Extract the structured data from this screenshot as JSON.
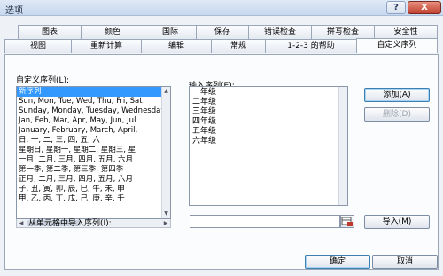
{
  "window": {
    "title": "选项",
    "help": "?",
    "close": "X"
  },
  "tabs_row1": [
    "图表",
    "颜色",
    "国际",
    "保存",
    "错误检查",
    "拼写检查",
    "安全性"
  ],
  "tabs_row2": [
    "视图",
    "重新计算",
    "编辑",
    "常规",
    "1-2-3 的帮助",
    "自定义序列"
  ],
  "active_tab": "自定义序列",
  "custom_lists": {
    "label": "自定义序列(L):",
    "items": [
      "新序列",
      "Sun, Mon, Tue, Wed, Thu, Fri, Sat",
      "Sunday, Monday, Tuesday, Wednesday",
      "Jan, Feb, Mar, Apr, May, Jun, Jul",
      "January, February, March, April,",
      "日, 一, 二, 三, 四, 五, 六",
      "星期日, 星期一, 星期二, 星期三, 星",
      "一月, 二月, 三月, 四月, 五月, 六月",
      "第一季, 第二季, 第三季, 第四季",
      "正月, 二月, 三月, 四月, 五月, 六月",
      "子, 丑, 寅, 卯, 辰, 巳, 午, 未, 申",
      "甲, 乙, 丙, 丁, 戊, 己, 庚, 辛, 壬"
    ],
    "selected_index": 0
  },
  "entries": {
    "label": "输入序列(E):",
    "lines": [
      "一年级",
      "二年级",
      "三年级",
      "四年级",
      "五年级",
      "六年级"
    ]
  },
  "buttons": {
    "add": "添加(A)",
    "delete": "删除(D)",
    "import": "导入(M)",
    "ok": "确定",
    "cancel": "取消"
  },
  "import_label": "从单元格中导入序列(I):",
  "colors": {
    "selection": "#3399ff",
    "close_red": "#c0402e",
    "dialog_bg": "#eef1f6"
  }
}
